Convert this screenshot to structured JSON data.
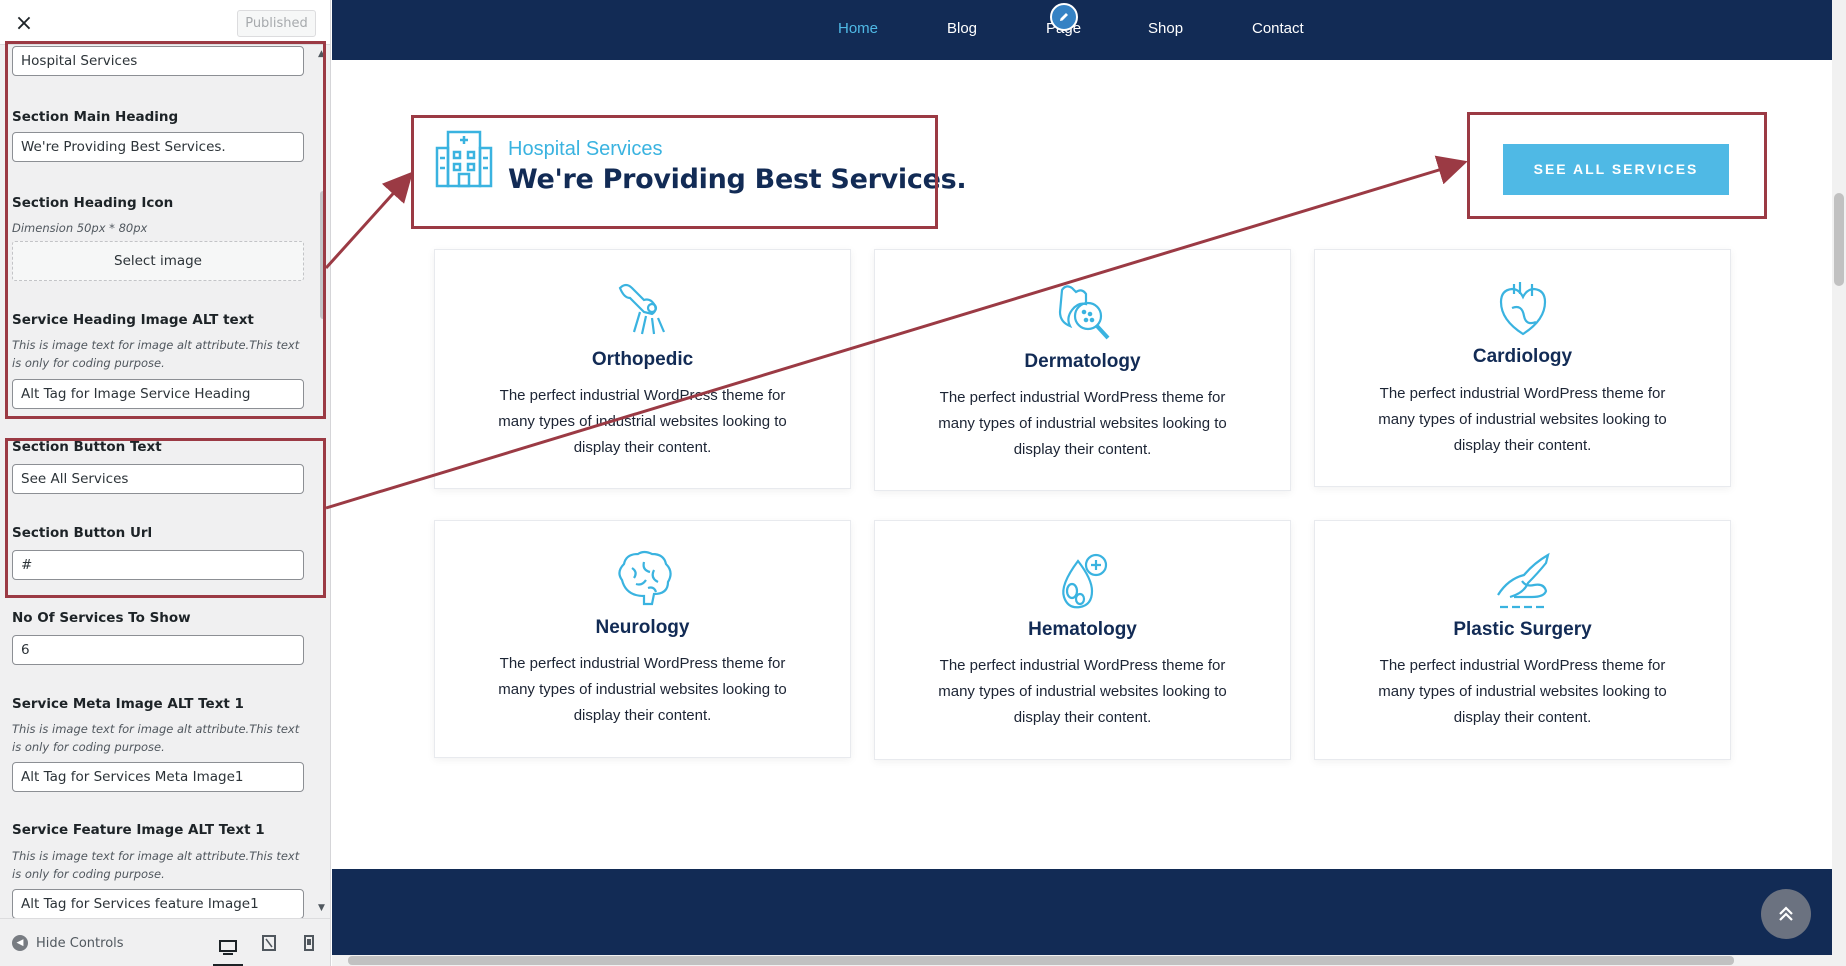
{
  "sidebar": {
    "close_icon": "×",
    "published_label": "Published",
    "fields": {
      "title_value": "Hospital Services",
      "main_heading_label": "Section Main Heading",
      "main_heading_value": "We're Providing Best Services.",
      "heading_icon_label": "Section Heading Icon",
      "heading_icon_dimension": "Dimension 50px * 80px",
      "select_image_label": "Select image",
      "heading_alt_label": "Service Heading Image ALT text",
      "heading_alt_desc": "This is image text for image alt attribute.This text is only for coding purpose.",
      "heading_alt_value": "Alt Tag for Image Service Heading",
      "button_text_label": "Section Button Text",
      "button_text_value": "See All Services",
      "button_url_label": "Section Button Url",
      "button_url_value": "#",
      "num_services_label": "No Of Services To Show",
      "num_services_value": "6",
      "meta_alt_label": "Service Meta Image ALT Text 1",
      "meta_alt_desc": "This is image text for image alt attribute.This text is only for coding purpose.",
      "meta_alt_value": "Alt Tag for Services Meta Image1",
      "feature_alt_label": "Service Feature Image ALT Text 1",
      "feature_alt_desc": "This is image text for image alt attribute.This text is only for coding purpose.",
      "feature_alt_value": "Alt Tag for Services feature Image1"
    },
    "footer": {
      "hide_controls_label": "Hide Controls",
      "devices": [
        "desktop-icon",
        "tablet-icon",
        "mobile-icon"
      ]
    }
  },
  "preview": {
    "nav": [
      "Home",
      "Blog",
      "Page",
      "Shop",
      "Contact"
    ],
    "heading_sub": "Hospital Services",
    "heading_main": "We're Providing Best Services.",
    "button_label": "SEE ALL SERVICES",
    "services": [
      {
        "title": "Orthopedic",
        "icon": "bone-joint-icon",
        "text": "The perfect industrial WordPress theme for many types of industrial websites looking to display their content."
      },
      {
        "title": "Dermatology",
        "icon": "skin-magnifier-icon",
        "text": "The perfect industrial WordPress theme for many types of industrial websites looking to display their content."
      },
      {
        "title": "Cardiology",
        "icon": "heart-icon",
        "text": "The perfect industrial WordPress theme for many types of industrial websites looking to display their content."
      },
      {
        "title": "Neurology",
        "icon": "brain-icon",
        "text": "The perfect industrial WordPress theme for many types of industrial websites looking to display their content."
      },
      {
        "title": "Hematology",
        "icon": "blood-drop-icon",
        "text": "The perfect industrial WordPress theme for many types of industrial websites looking to display their content."
      },
      {
        "title": "Plastic Surgery",
        "icon": "scalpel-hand-icon",
        "text": "The perfect industrial WordPress theme for many types of industrial websites looking to display their content."
      }
    ]
  },
  "colors": {
    "navy": "#122b55",
    "accent": "#4fb9e5",
    "highlight_red": "#9b3a44"
  }
}
